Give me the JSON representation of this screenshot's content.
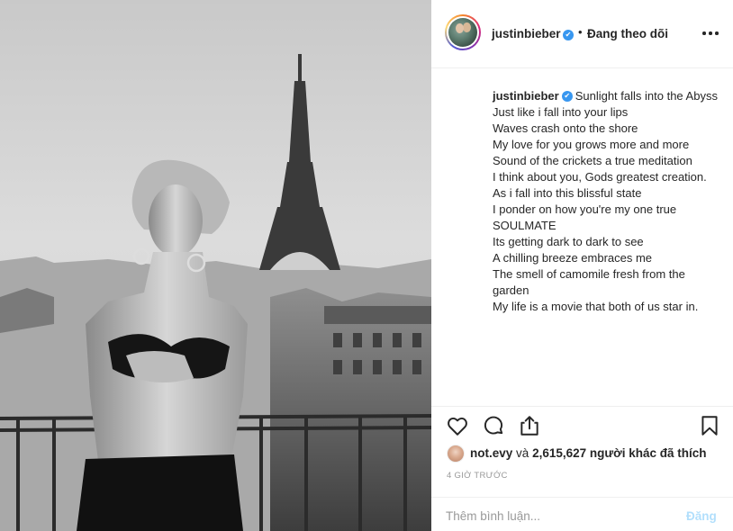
{
  "post": {
    "image_alt": "Black and white photo of a woman on a Paris balcony with the Eiffel Tower behind"
  },
  "header": {
    "username": "justinbieber",
    "verified_mark": "✔",
    "separator": "•",
    "follow_status": "Đang theo dõi",
    "more_icon": "more-horizontal-icon"
  },
  "caption": {
    "username": "justinbieber",
    "first_line": "Sunlight falls into the Abyss",
    "lines": [
      "Just like i fall into your lips",
      "Waves crash onto the shore",
      "My love for you grows more and more",
      "Sound of the crickets a true meditation",
      "I think about you, Gods greatest creation.",
      "As i fall into this blissful state",
      "I ponder on how you're my one true SOULMATE",
      "Its getting dark to dark to see",
      "A chilling breeze embraces me",
      "The smell of camomile fresh from the garden",
      "My life is a movie that both of us star in."
    ]
  },
  "actions": {
    "like_icon": "heart-icon",
    "comment_icon": "comment-icon",
    "share_icon": "share-icon",
    "save_icon": "bookmark-icon"
  },
  "likes": {
    "user": "not.evy",
    "connector": "và",
    "count": "2,615,627",
    "suffix": "người khác đã thích"
  },
  "timestamp": "4 GIỜ TRƯỚC",
  "comment": {
    "placeholder": "Thêm bình luận...",
    "post_label": "Đăng"
  }
}
